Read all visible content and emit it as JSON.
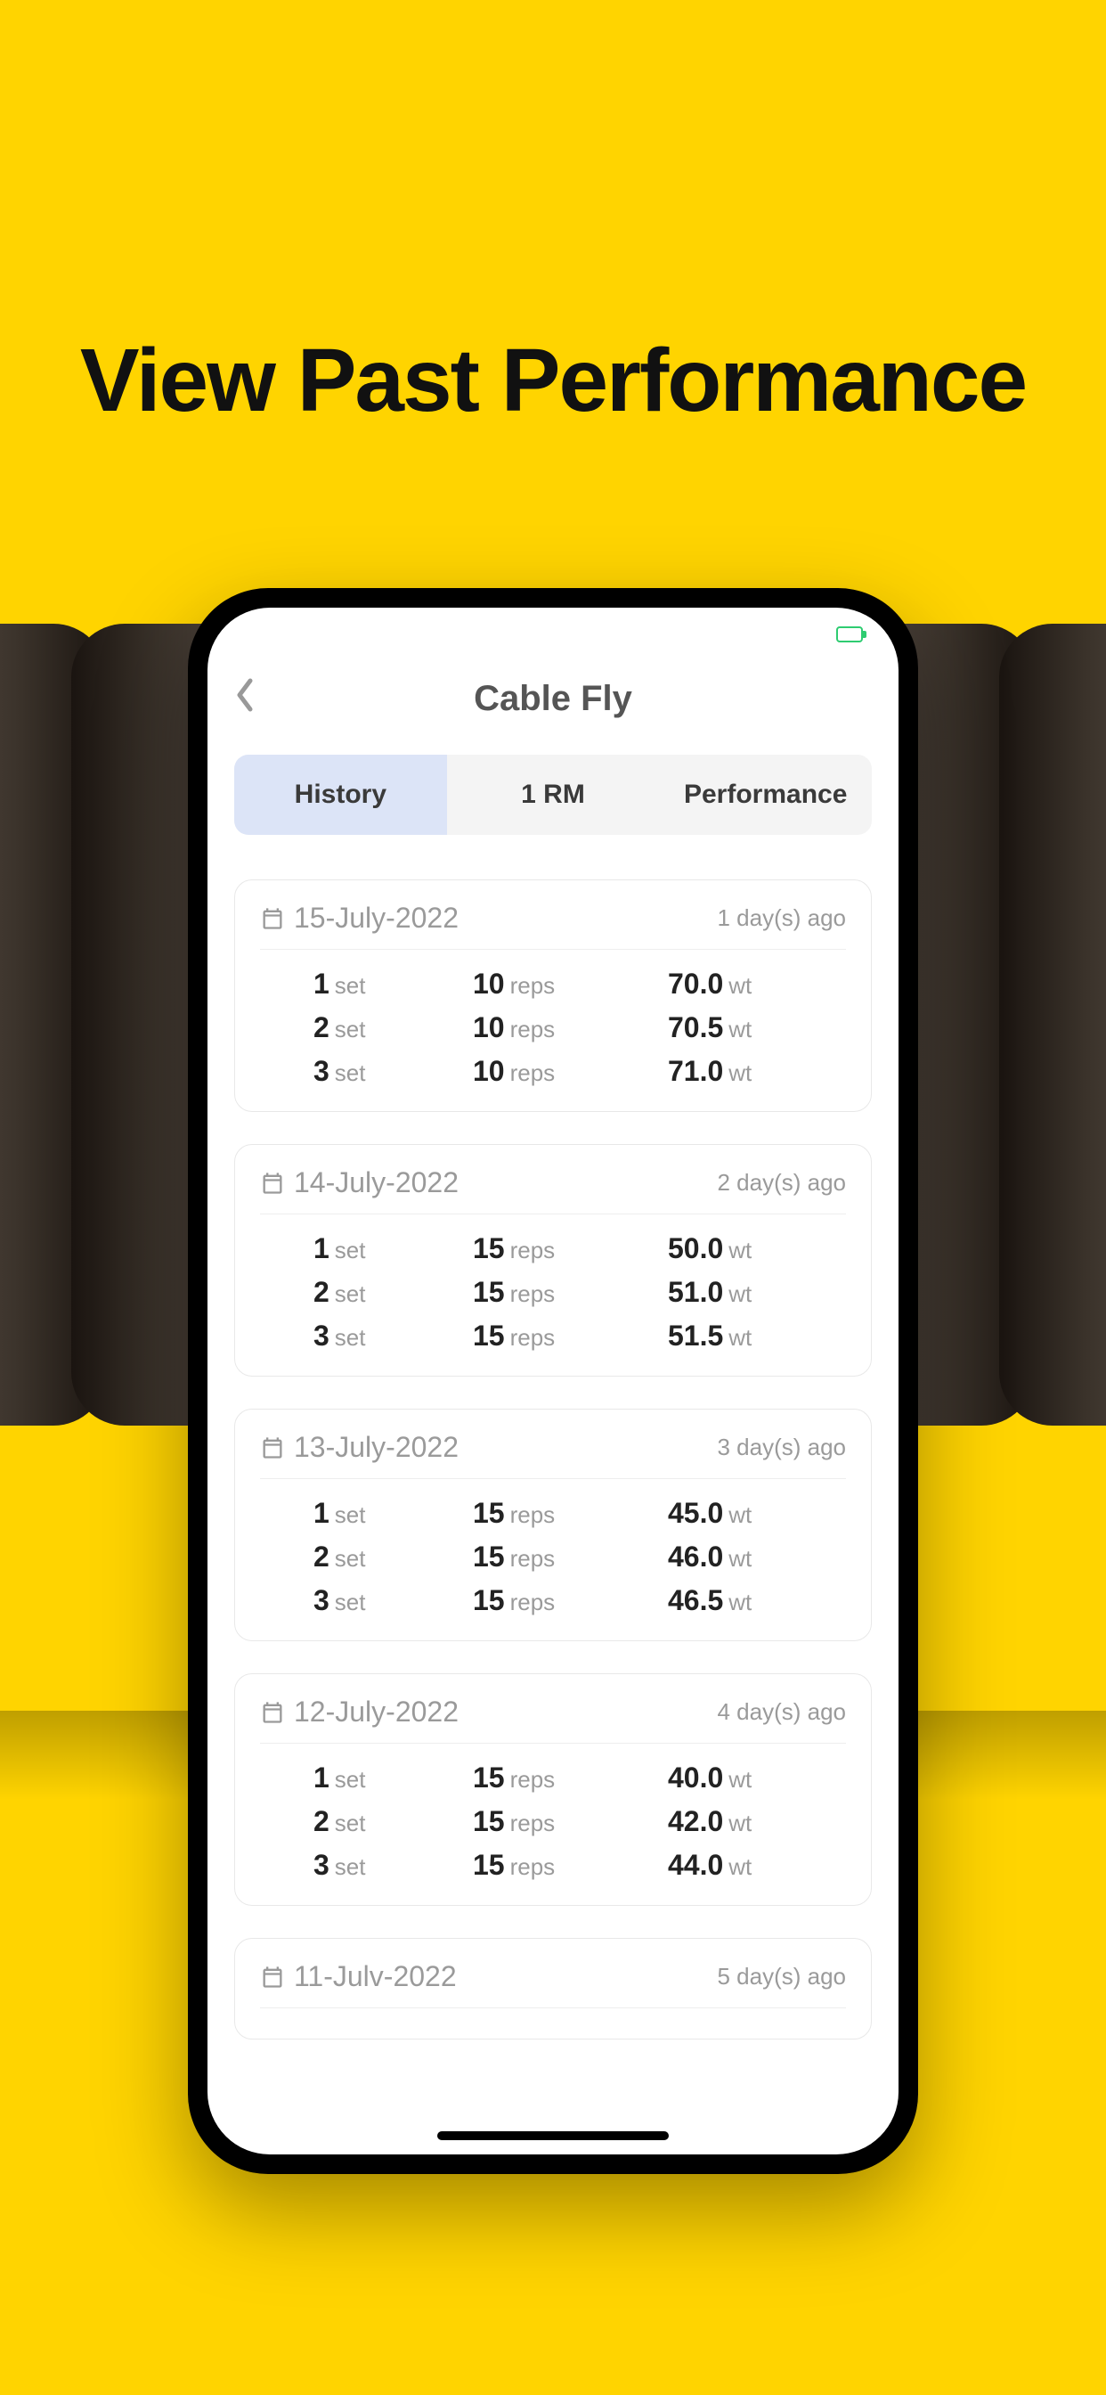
{
  "hero": {
    "title": "View Past Performance"
  },
  "app": {
    "title": "Cable Fly",
    "tabs": [
      {
        "label": "History",
        "active": true
      },
      {
        "label": "1 RM",
        "active": false
      },
      {
        "label": "Performance",
        "active": false
      }
    ]
  },
  "units": {
    "set": "set",
    "reps": "reps",
    "wt": "wt"
  },
  "history": [
    {
      "date": "15-July-2022",
      "ago": "1 day(s) ago",
      "sets": [
        {
          "set": "1",
          "reps": "10",
          "wt": "70.0"
        },
        {
          "set": "2",
          "reps": "10",
          "wt": "70.5"
        },
        {
          "set": "3",
          "reps": "10",
          "wt": "71.0"
        }
      ]
    },
    {
      "date": "14-July-2022",
      "ago": "2 day(s) ago",
      "sets": [
        {
          "set": "1",
          "reps": "15",
          "wt": "50.0"
        },
        {
          "set": "2",
          "reps": "15",
          "wt": "51.0"
        },
        {
          "set": "3",
          "reps": "15",
          "wt": "51.5"
        }
      ]
    },
    {
      "date": "13-July-2022",
      "ago": "3 day(s) ago",
      "sets": [
        {
          "set": "1",
          "reps": "15",
          "wt": "45.0"
        },
        {
          "set": "2",
          "reps": "15",
          "wt": "46.0"
        },
        {
          "set": "3",
          "reps": "15",
          "wt": "46.5"
        }
      ]
    },
    {
      "date": "12-July-2022",
      "ago": "4 day(s) ago",
      "sets": [
        {
          "set": "1",
          "reps": "15",
          "wt": "40.0"
        },
        {
          "set": "2",
          "reps": "15",
          "wt": "42.0"
        },
        {
          "set": "3",
          "reps": "15",
          "wt": "44.0"
        }
      ]
    },
    {
      "date": "11-Julv-2022",
      "ago": "5 day(s) ago",
      "sets": []
    }
  ]
}
